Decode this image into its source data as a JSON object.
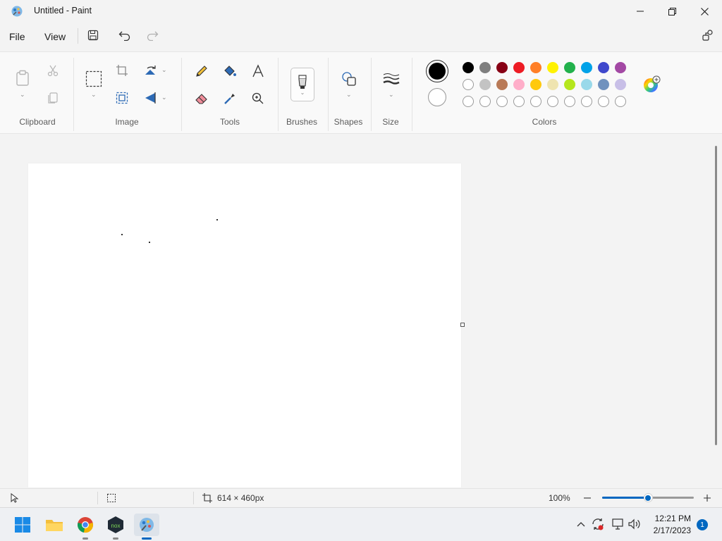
{
  "window": {
    "title": "Untitled - Paint",
    "app_icon": "paint-palette-icon",
    "controls": [
      "minimize-icon",
      "maximize-icon",
      "close-icon"
    ]
  },
  "menu": {
    "file": "File",
    "view": "View",
    "quick_access": [
      "save-icon",
      "undo-icon",
      "redo-icon"
    ],
    "right_icon": "share-icon"
  },
  "ribbon": {
    "clipboard": {
      "label": "Clipboard",
      "icons": [
        "paste-icon",
        "cut-icon",
        "copy-icon"
      ]
    },
    "image": {
      "label": "Image",
      "icons": [
        "select-rectangle-icon",
        "crop-icon",
        "resize-icon",
        "rotate-icon",
        "flip-icon"
      ]
    },
    "tools": {
      "label": "Tools",
      "icons": [
        "pencil-icon",
        "fill-bucket-icon",
        "text-icon",
        "eraser-icon",
        "color-picker-icon",
        "magnifier-icon"
      ]
    },
    "brushes": {
      "label": "Brushes",
      "icon": "brush-icon"
    },
    "shapes": {
      "label": "Shapes",
      "icon": "shapes-icon"
    },
    "size": {
      "label": "Size",
      "icon": "line-size-icon"
    },
    "colors": {
      "label": "Colors",
      "primary": "#000000",
      "secondary": "#ffffff",
      "row1": [
        "#000000",
        "#7f7f7f",
        "#880015",
        "#ed1c24",
        "#ff7f27",
        "#fff200",
        "#22b14c",
        "#00a2e8",
        "#3f48cc",
        "#a349a4"
      ],
      "row2": [
        "#ffffff",
        "#c3c3c3",
        "#b97a57",
        "#ffaec9",
        "#ffc90e",
        "#efe4b0",
        "#b5e61d",
        "#99d9ea",
        "#7092be",
        "#c8bfe7"
      ],
      "edit_icon": "edit-colors-icon"
    }
  },
  "canvas": {
    "size_text": "614 × 460px"
  },
  "status": {
    "pointer_icon": "pointer-icon",
    "selection_icon": "selection-size-icon",
    "canvas_icon": "canvas-size-icon",
    "zoom": "100%",
    "zoom_level": 0.5
  },
  "taskbar": {
    "apps": [
      "windows-start-icon",
      "file-explorer-icon",
      "chrome-icon",
      "nox-player-icon",
      "paint-icon"
    ],
    "time": "12:21 PM",
    "date": "2/17/2023",
    "notifications": "1"
  }
}
